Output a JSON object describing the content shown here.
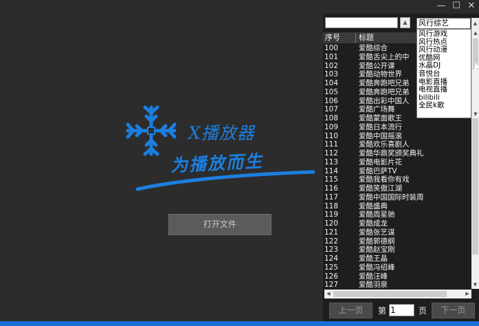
{
  "window": {
    "minimize_glyph": "—",
    "maximize_glyph": "☐",
    "close_glyph": "✕"
  },
  "logo": {
    "title": "X播放器",
    "slogan": "为播放而生",
    "brand_color": "#1c7fe0",
    "icon": "snowflake-icon"
  },
  "player": {
    "open_file_label": "打开文件"
  },
  "search": {
    "placeholder": ""
  },
  "source_combo": {
    "selected": "风行综艺",
    "options": [
      "风行游戏",
      "风行热点",
      "风行动漫",
      "优酷网",
      "水晶DJ",
      "音悦台",
      "电影直播",
      "电视直播",
      "bilibili",
      "全民k歌"
    ]
  },
  "table": {
    "headers": {
      "num": "序号",
      "title": "标题"
    },
    "rows": [
      {
        "num": "100",
        "title": "爱酷综合"
      },
      {
        "num": "101",
        "title": "爱酷舌尖上的中"
      },
      {
        "num": "102",
        "title": "爱酷公开课"
      },
      {
        "num": "103",
        "title": "爱酷动物世界"
      },
      {
        "num": "104",
        "title": "爱酷奔跑吧兄弟"
      },
      {
        "num": "105",
        "title": "爱酷奔跑吧兄弟"
      },
      {
        "num": "106",
        "title": "爱酷出彩中国人"
      },
      {
        "num": "107",
        "title": "爱酷广场舞"
      },
      {
        "num": "108",
        "title": "爱酷蒙面歌王"
      },
      {
        "num": "109",
        "title": "爱酷日本流行"
      },
      {
        "num": "110",
        "title": "爱酷中国摇滚"
      },
      {
        "num": "111",
        "title": "爱酷欢乐喜剧人"
      },
      {
        "num": "112",
        "title": "爱酷华鼎奖颁奖典礼"
      },
      {
        "num": "113",
        "title": "爱酷电影片花"
      },
      {
        "num": "114",
        "title": "爱酷巴萨TV"
      },
      {
        "num": "115",
        "title": "爱酷我看你有戏"
      },
      {
        "num": "116",
        "title": "爱酷笑傲江湖"
      },
      {
        "num": "117",
        "title": "爱酷中国国际时装周"
      },
      {
        "num": "118",
        "title": "爱酷盛典"
      },
      {
        "num": "119",
        "title": "爱酷周星驰"
      },
      {
        "num": "120",
        "title": "爱酷成龙"
      },
      {
        "num": "121",
        "title": "爱酷张艺谋"
      },
      {
        "num": "122",
        "title": "爱酷郭德纲"
      },
      {
        "num": "123",
        "title": "爱酷赵宝刚"
      },
      {
        "num": "124",
        "title": "爱酷王晶"
      },
      {
        "num": "125",
        "title": "爱酷冯绍峰"
      },
      {
        "num": "126",
        "title": "爱酷汪峰"
      },
      {
        "num": "127",
        "title": "爱酷羽泉"
      }
    ]
  },
  "pager": {
    "prev_label": "上一页",
    "page_prefix": "第",
    "page_value": "1",
    "page_suffix": "页",
    "next_label": "下一页"
  },
  "colors": {
    "accent": "#1c6ed8",
    "background": "#2b2b2b",
    "panel": "#1e1e1e"
  }
}
